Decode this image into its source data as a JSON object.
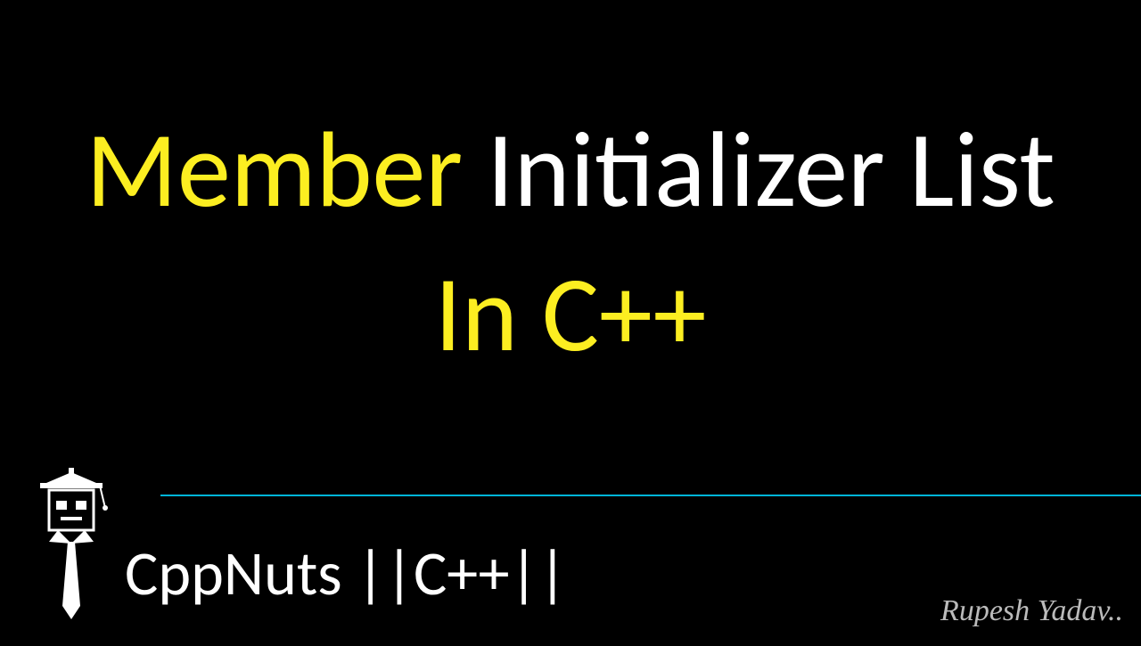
{
  "title": {
    "word1": "Member",
    "word2": "Initializer List",
    "line2": "In C++"
  },
  "channel": "CppNuts ||C++||",
  "signature": "Rupesh Yadav..",
  "colors": {
    "background": "#000000",
    "yellow": "#fcee21",
    "white": "#ffffff",
    "divider": "#00b4d8"
  }
}
